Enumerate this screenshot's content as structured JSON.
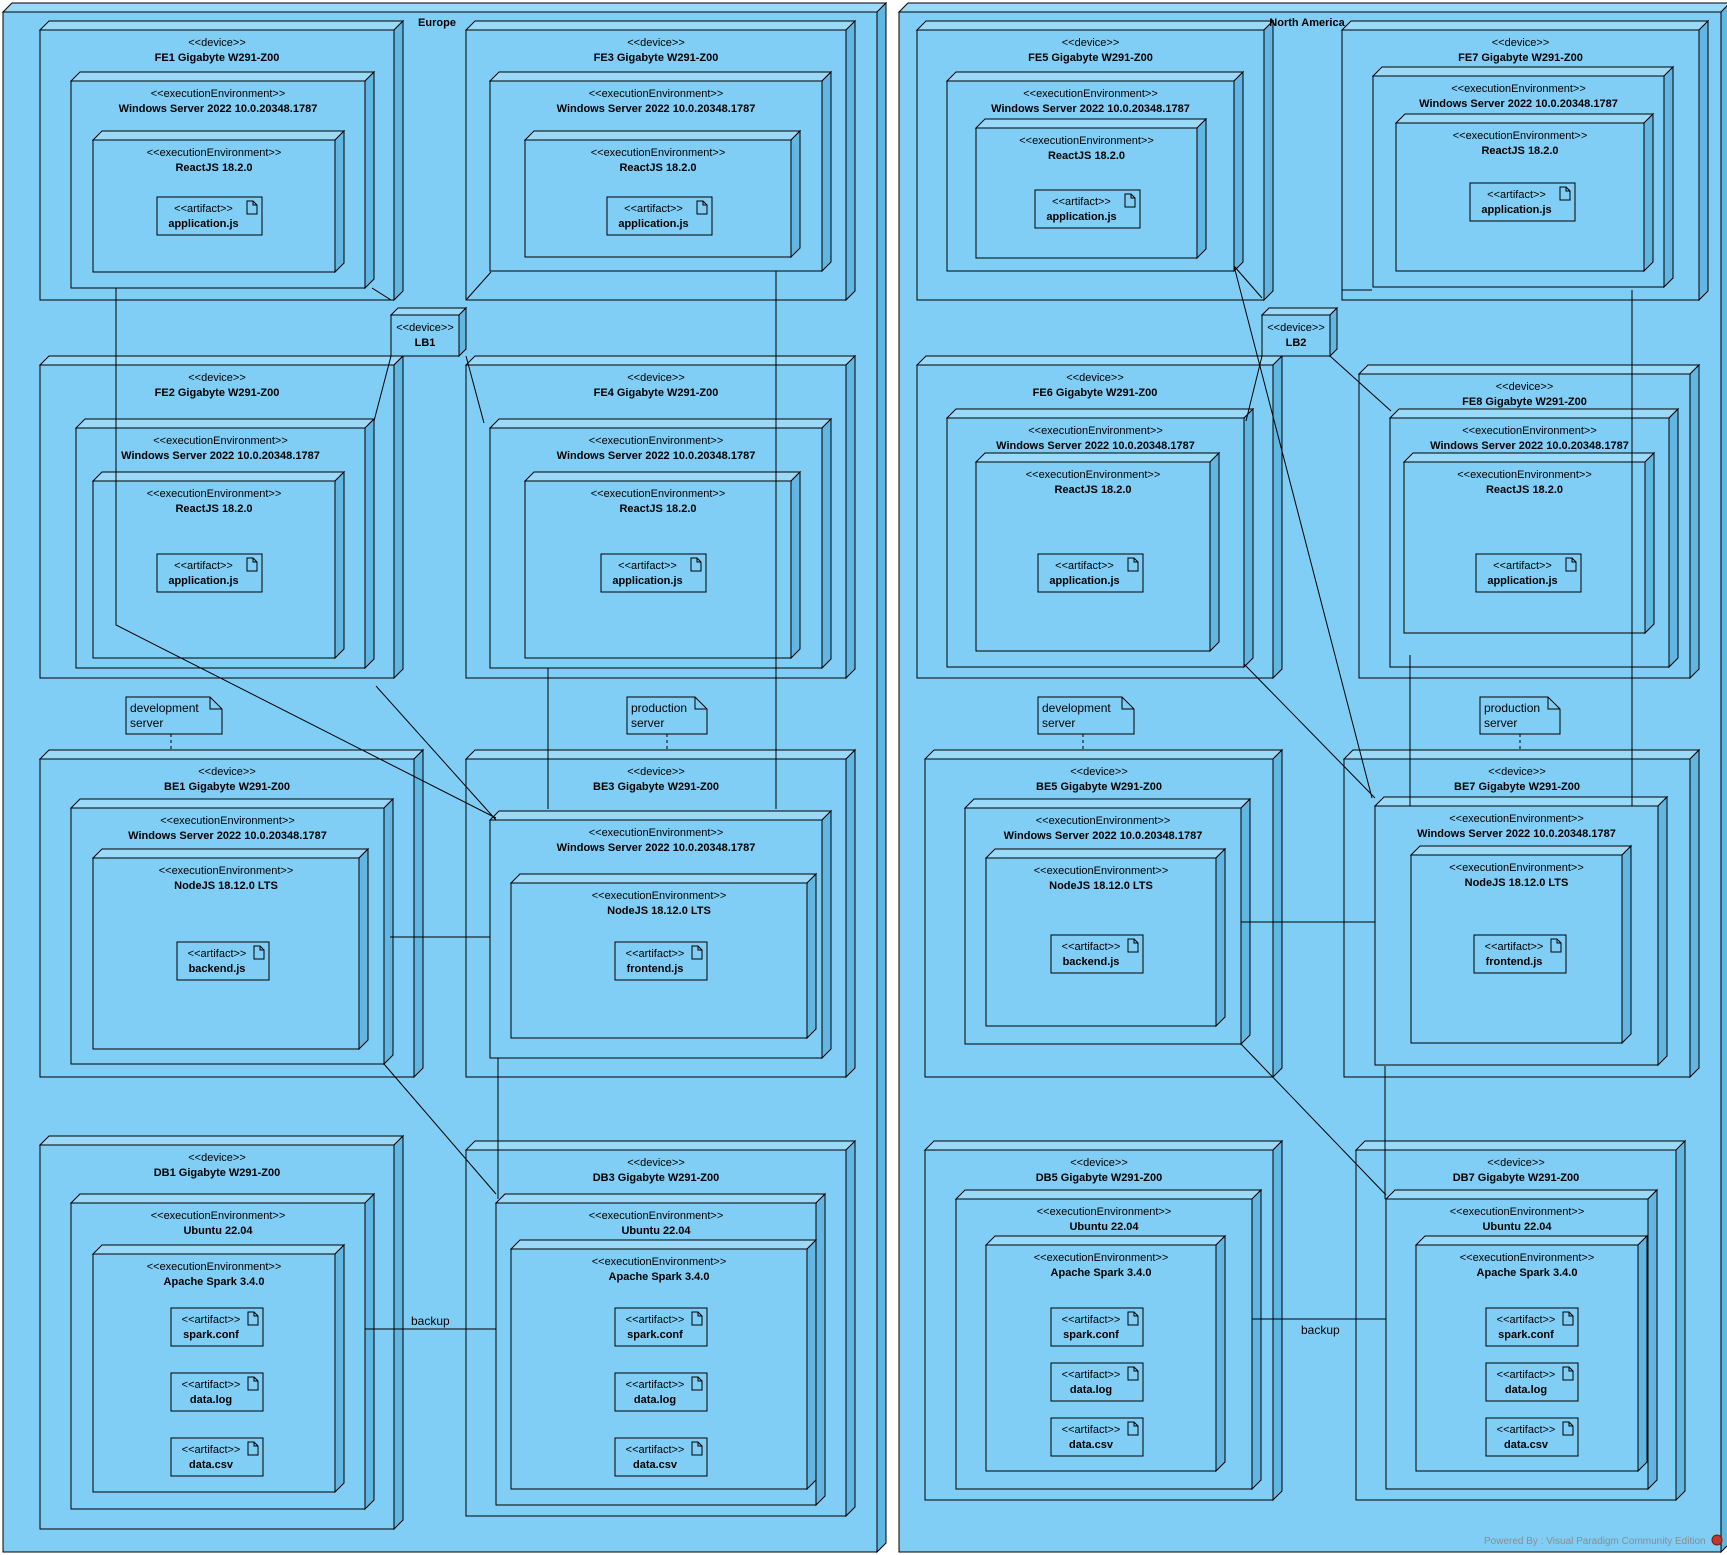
{
  "regions": [
    {
      "label": "Europe"
    },
    {
      "label": "North America"
    }
  ],
  "devices": [
    {
      "label": "FE1 Gigabyte W291-Z00"
    },
    {
      "label": "FE3 Gigabyte W291-Z00"
    },
    {
      "label": "FE2 Gigabyte W291-Z00"
    },
    {
      "label": "FE4 Gigabyte W291-Z00"
    },
    {
      "label": "BE1 Gigabyte W291-Z00"
    },
    {
      "label": "BE3 Gigabyte W291-Z00"
    },
    {
      "label": "DB1 Gigabyte W291-Z00"
    },
    {
      "label": "DB3 Gigabyte W291-Z00"
    },
    {
      "label": "FE5 Gigabyte W291-Z00"
    },
    {
      "label": "FE7 Gigabyte W291-Z00"
    },
    {
      "label": "FE6 Gigabyte W291-Z00"
    },
    {
      "label": "FE8 Gigabyte W291-Z00"
    },
    {
      "label": "BE5 Gigabyte W291-Z00"
    },
    {
      "label": "BE7 Gigabyte W291-Z00"
    },
    {
      "label": "DB5 Gigabyte W291-Z00"
    },
    {
      "label": "DB7 Gigabyte W291-Z00"
    },
    {
      "label": "LB1"
    },
    {
      "label": "LB2"
    }
  ],
  "environments": [
    {
      "label": "Windows Server 2022 10.0.20348.1787"
    },
    {
      "label": "ReactJS 18.2.0"
    },
    {
      "label": "NodeJS 18.12.0 LTS"
    },
    {
      "label": "Ubuntu 22.04"
    },
    {
      "label": "Apache Spark 3.4.0"
    }
  ],
  "artifacts": [
    {
      "label": "application.js"
    },
    {
      "label": "backend.js"
    },
    {
      "label": "frontend.js"
    },
    {
      "label": "spark.conf"
    },
    {
      "label": "data.log"
    },
    {
      "label": "data.csv"
    }
  ],
  "stereotypes": {
    "device": "<<device>>",
    "execution_environment": "<<executionEnvironment>>",
    "artifact": "<<artifact>>"
  },
  "notes": {
    "development_line1": "development",
    "development_line2": "server",
    "production_line1": "production",
    "production_line2": "server"
  },
  "connector_labels": {
    "backup": "backup"
  },
  "watermark": "Powered By : Visual Paradigm Community Edition",
  "colors": {
    "node_fill": "#80CEF5",
    "node_top": "#9ADAF8",
    "node_side": "#62B6E2",
    "outline": "#000000"
  }
}
